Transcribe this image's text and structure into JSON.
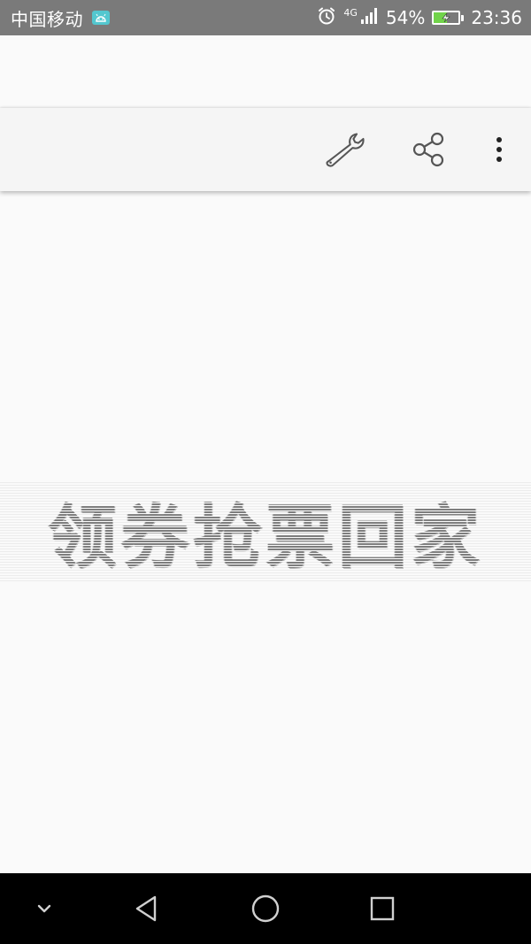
{
  "status_bar": {
    "carrier": "中国移动",
    "network_type": "4G",
    "battery_percent": "54%",
    "battery_level": 0.54,
    "time": "23:36",
    "icons": [
      "android-icon",
      "alarm-icon",
      "signal-icon",
      "battery-charging-icon"
    ]
  },
  "toolbar": {
    "actions": [
      {
        "name": "settings",
        "icon": "wrench-icon"
      },
      {
        "name": "share",
        "icon": "share-icon"
      },
      {
        "name": "more",
        "icon": "more-vert-icon"
      }
    ]
  },
  "banner": {
    "text": "领券抢票回家"
  },
  "navigation_bar": {
    "buttons": [
      "collapse-icon",
      "back-icon",
      "home-icon",
      "recents-icon"
    ]
  },
  "colors": {
    "status_bar_bg": "#7a7a7a",
    "app_bar_bg": "#f5f5f5",
    "banner_text": "#7e7e7e",
    "battery_fill": "#71d34a",
    "badge": "#53c7cf",
    "nav_bar_bg": "#000000"
  }
}
